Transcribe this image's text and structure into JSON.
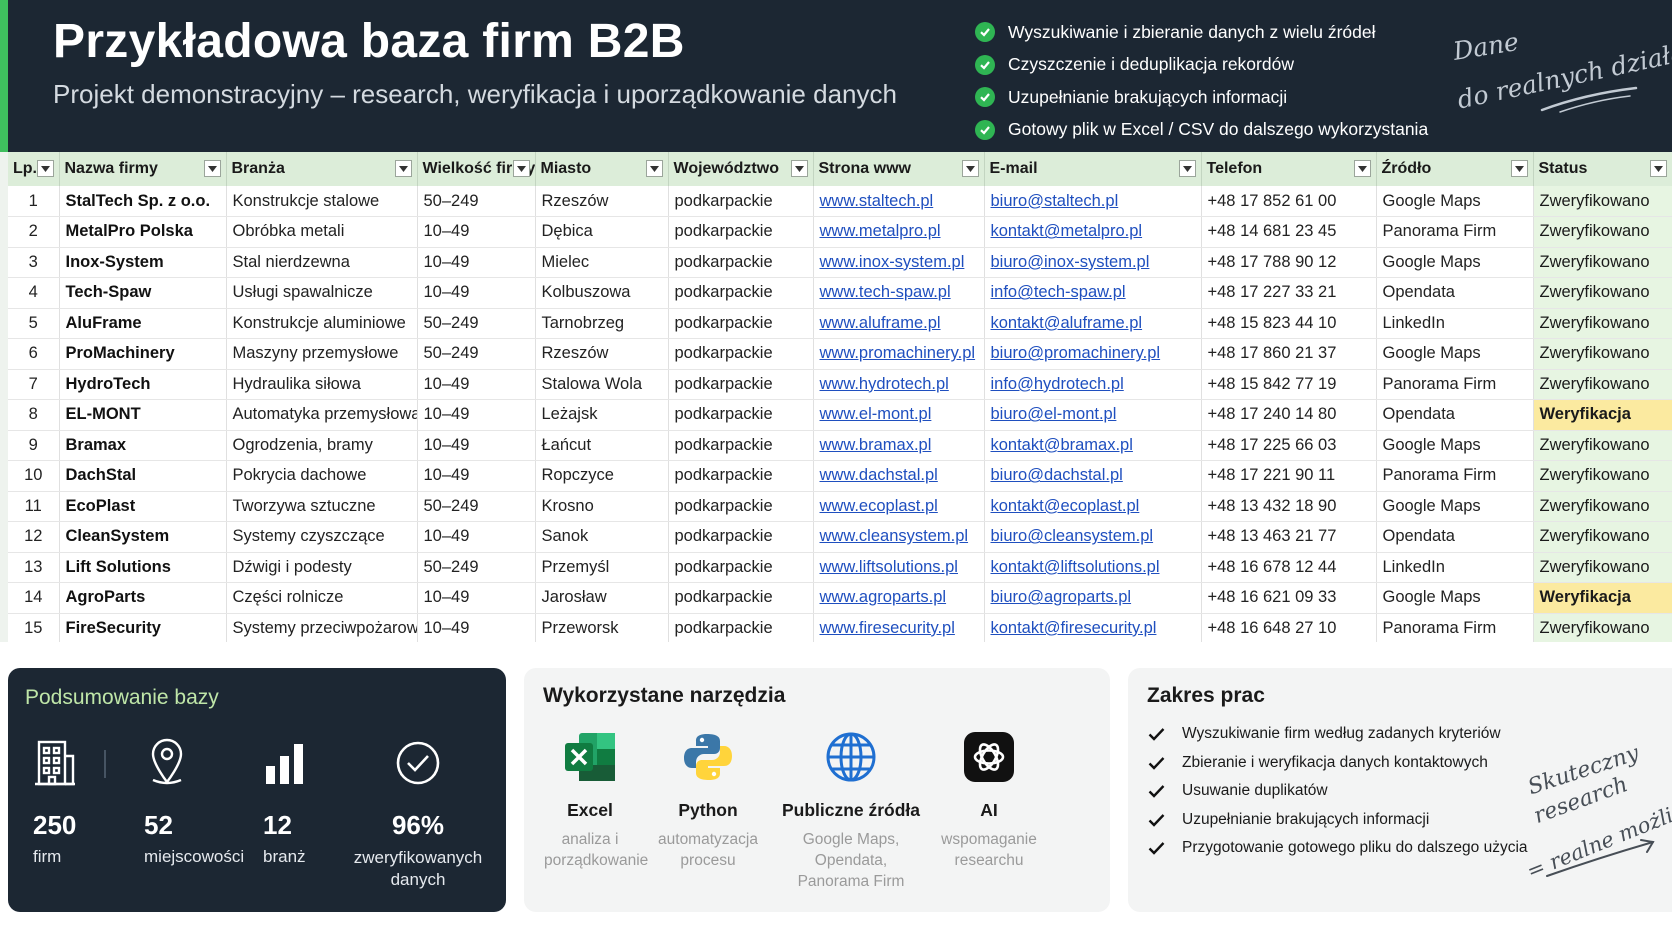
{
  "header": {
    "title": "Przykładowa baza firm B2B",
    "subtitle": "Projekt demonstracyjny – research, weryfikacja i uporządkowanie danych",
    "features": [
      "Wyszukiwanie i zbieranie danych z wielu źródeł",
      "Czyszczenie i deduplikacja rekordów",
      "Uzupełnianie brakujących informacji",
      "Gotowy plik w Excel / CSV do dalszego wykorzystania"
    ],
    "script_line1": "Dane",
    "script_line2": "do realnych działań"
  },
  "colors": {
    "header_bg": "#1c2733",
    "accent_green": "#3fbf5e",
    "table_header_bg": "#dcedd9",
    "status_ok_bg": "#e7f5e2",
    "status_pending_bg": "#fbeaa0",
    "link": "#1f4fbf"
  },
  "table": {
    "columns": [
      "Lp.",
      "Nazwa firmy",
      "Branża",
      "Wielkość firmy",
      "Miasto",
      "Województwo",
      "Strona www",
      "E-mail",
      "Telefon",
      "Źródło",
      "Status"
    ],
    "rows": [
      [
        "1",
        "StalTech Sp. z o.o.",
        "Konstrukcje stalowe",
        "50–249",
        "Rzeszów",
        "podkarpackie",
        "www.staltech.pl",
        "biuro@staltech.pl",
        "+48 17 852 61 00",
        "Google Maps",
        "Zweryfikowano"
      ],
      [
        "2",
        "MetalPro Polska",
        "Obróbka metali",
        "10–49",
        "Dębica",
        "podkarpackie",
        "www.metalpro.pl",
        "kontakt@metalpro.pl",
        "+48 14 681 23 45",
        "Panorama Firm",
        "Zweryfikowano"
      ],
      [
        "3",
        "Inox-System",
        "Stal nierdzewna",
        "10–49",
        "Mielec",
        "podkarpackie",
        "www.inox-system.pl",
        "biuro@inox-system.pl",
        "+48 17 788 90 12",
        "Google Maps",
        "Zweryfikowano"
      ],
      [
        "4",
        "Tech-Spaw",
        "Usługi spawalnicze",
        "10–49",
        "Kolbuszowa",
        "podkarpackie",
        "www.tech-spaw.pl",
        "info@tech-spaw.pl",
        "+48 17 227 33 21",
        "Opendata",
        "Zweryfikowano"
      ],
      [
        "5",
        "AluFrame",
        "Konstrukcje aluminiowe",
        "50–249",
        "Tarnobrzeg",
        "podkarpackie",
        "www.aluframe.pl",
        "kontakt@aluframe.pl",
        "+48 15 823 44 10",
        "LinkedIn",
        "Zweryfikowano"
      ],
      [
        "6",
        "ProMachinery",
        "Maszyny przemysłowe",
        "50–249",
        "Rzeszów",
        "podkarpackie",
        "www.promachinery.pl",
        "biuro@promachinery.pl",
        "+48 17 860 21 37",
        "Google Maps",
        "Zweryfikowano"
      ],
      [
        "7",
        "HydroTech",
        "Hydraulika siłowa",
        "10–49",
        "Stalowa Wola",
        "podkarpackie",
        "www.hydrotech.pl",
        "info@hydrotech.pl",
        "+48 15 842 77 19",
        "Panorama Firm",
        "Zweryfikowano"
      ],
      [
        "8",
        "EL-MONT",
        "Automatyka przemysłowa",
        "10–49",
        "Leżajsk",
        "podkarpackie",
        "www.el-mont.pl",
        "biuro@el-mont.pl",
        "+48 17 240 14 80",
        "Opendata",
        "Weryfikacja"
      ],
      [
        "9",
        "Bramax",
        "Ogrodzenia, bramy",
        "10–49",
        "Łańcut",
        "podkarpackie",
        "www.bramax.pl",
        "kontakt@bramax.pl",
        "+48 17 225 66 03",
        "Google Maps",
        "Zweryfikowano"
      ],
      [
        "10",
        "DachStal",
        "Pokrycia dachowe",
        "10–49",
        "Ropczyce",
        "podkarpackie",
        "www.dachstal.pl",
        "biuro@dachstal.pl",
        "+48 17 221 90 11",
        "Panorama Firm",
        "Zweryfikowano"
      ],
      [
        "11",
        "EcoPlast",
        "Tworzywa sztuczne",
        "50–249",
        "Krosno",
        "podkarpackie",
        "www.ecoplast.pl",
        "kontakt@ecoplast.pl",
        "+48 13 432 18 90",
        "Google Maps",
        "Zweryfikowano"
      ],
      [
        "12",
        "CleanSystem",
        "Systemy czyszczące",
        "10–49",
        "Sanok",
        "podkarpackie",
        "www.cleansystem.pl",
        "biuro@cleansystem.pl",
        "+48 13 463 21 77",
        "Opendata",
        "Zweryfikowano"
      ],
      [
        "13",
        "Lift Solutions",
        "Dźwigi i podesty",
        "50–249",
        "Przemyśl",
        "podkarpackie",
        "www.liftsolutions.pl",
        "kontakt@liftsolutions.pl",
        "+48 16 678 12 44",
        "LinkedIn",
        "Zweryfikowano"
      ],
      [
        "14",
        "AgroParts",
        "Części rolnicze",
        "10–49",
        "Jarosław",
        "podkarpackie",
        "www.agroparts.pl",
        "biuro@agroparts.pl",
        "+48 16 621 09 33",
        "Google Maps",
        "Weryfikacja"
      ],
      [
        "15",
        "FireSecurity",
        "Systemy przeciwpożarowe",
        "10–49",
        "Przeworsk",
        "podkarpackie",
        "www.firesecurity.pl",
        "kontakt@firesecurity.pl",
        "+48 16 648 27 10",
        "Panorama Firm",
        "Zweryfikowano"
      ]
    ]
  },
  "summary": {
    "title": "Podsumowanie bazy",
    "stats": [
      {
        "value": "250",
        "label": "firm",
        "icon": "building-icon"
      },
      {
        "value": "52",
        "label": "miejscowości",
        "icon": "location-pin-icon"
      },
      {
        "value": "12",
        "label": "branż",
        "icon": "bar-chart-icon"
      },
      {
        "value": "96%",
        "label": "zweryfikowanych danych",
        "icon": "check-circle-icon"
      }
    ]
  },
  "tools": {
    "title": "Wykorzystane narzędzia",
    "items": [
      {
        "name": "Excel",
        "desc": "analiza i porządkowanie",
        "icon": "excel-icon"
      },
      {
        "name": "Python",
        "desc": "automatyzacja procesu",
        "icon": "python-icon"
      },
      {
        "name": "Publiczne źródła",
        "desc": "Google Maps, Opendata, Panorama Firm",
        "icon": "globe-icon"
      },
      {
        "name": "AI",
        "desc": "wspomaganie researchu",
        "icon": "ai-icon"
      }
    ]
  },
  "scope": {
    "title": "Zakres prac",
    "items": [
      "Wyszukiwanie firm według zadanych kryteriów",
      "Zbieranie i weryfikacja danych kontaktowych",
      "Usuwanie duplikatów",
      "Uzupełnianie brakujących informacji",
      "Przygotowanie gotowego pliku do dalszego użycia"
    ],
    "script_line1": "Skuteczny",
    "script_line2": "research",
    "script_line3": "= realne możliwości"
  }
}
